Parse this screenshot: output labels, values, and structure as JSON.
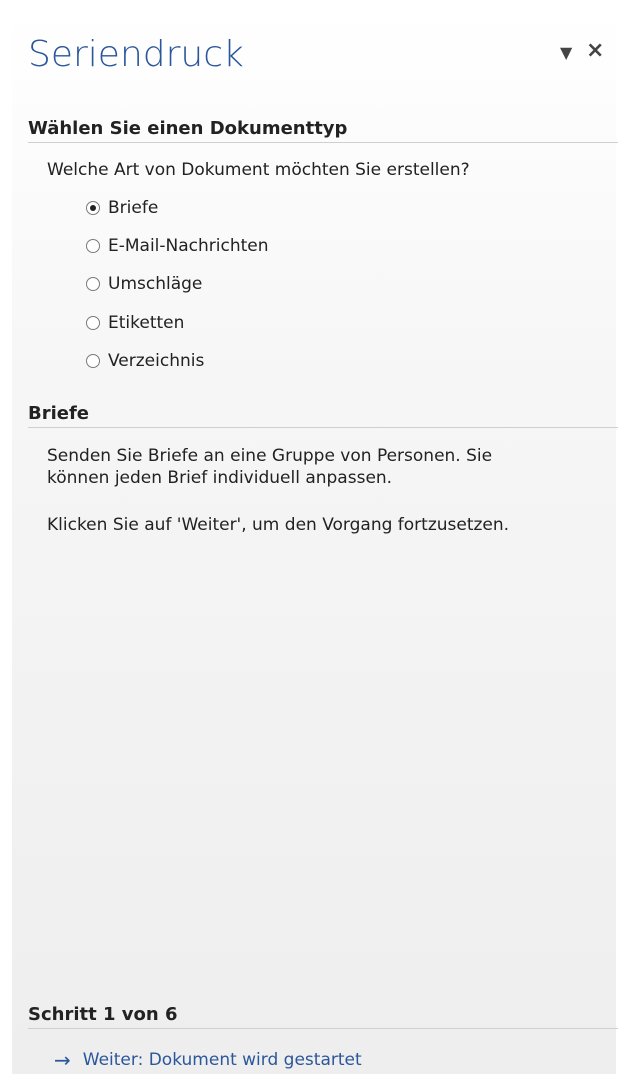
{
  "pane": {
    "title": "Seriendruck",
    "dropdown_icon": "▼",
    "close_icon": "×"
  },
  "doc_type": {
    "heading": "Wählen Sie einen Dokumenttyp",
    "question": "Welche Art von Dokument möchten Sie erstellen?",
    "options": [
      {
        "label": "Briefe",
        "checked": true
      },
      {
        "label": "E-Mail-Nachrichten",
        "checked": false
      },
      {
        "label": "Umschläge",
        "checked": false
      },
      {
        "label": "Etiketten",
        "checked": false
      },
      {
        "label": "Verzeichnis",
        "checked": false
      }
    ]
  },
  "description": {
    "heading": "Briefe",
    "line1": "Senden Sie Briefe an eine Gruppe von Personen. Sie",
    "line2": "können jeden Brief individuell anpassen.",
    "line3": "Klicken Sie auf 'Weiter', um den Vorgang fortzusetzen."
  },
  "footer": {
    "step": "Schritt 1 von 6",
    "next_icon": "→",
    "next_label": "Weiter: Dokument wird gestartet"
  }
}
